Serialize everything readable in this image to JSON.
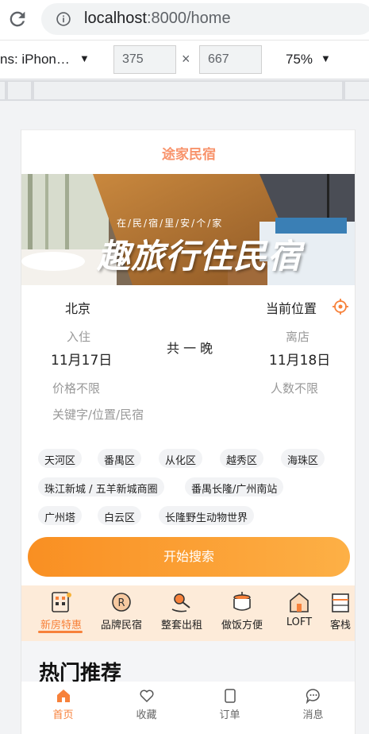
{
  "browser": {
    "url_host": "localhost",
    "url_path": ":8000/home",
    "device": "ns: iPhon…",
    "width": "375",
    "height": "667",
    "size_separator": "×",
    "zoom": "75%",
    "caret": "▼"
  },
  "app": {
    "title": "途家民宿",
    "banner_sub": "在/民/宿/里/安/个/家",
    "banner_main": "趣旅行住民宿"
  },
  "search": {
    "city": "北京",
    "current_location": "当前位置",
    "checkin_label": "入住",
    "checkin_date": "11月17日",
    "nights": "共 一 晚",
    "checkout_label": "离店",
    "checkout_date": "11月18日",
    "price": "价格不限",
    "people": "人数不限",
    "keyword_placeholder": "关键字/位置/民宿",
    "tags": [
      "天河区",
      "番禺区",
      "从化区",
      "越秀区",
      "海珠区",
      "珠江新城 / 五羊新城商圈",
      "番禺长隆/广州南站",
      "广州塔",
      "白云区",
      "长隆野生动物世界"
    ],
    "button": "开始搜索"
  },
  "categories": [
    "新房特惠",
    "品牌民宿",
    "整套出租",
    "做饭方便",
    "LOFT",
    "客栈"
  ],
  "hot": {
    "title": "热门推荐"
  },
  "tabbar": [
    "首页",
    "收藏",
    "订单",
    "消息"
  ],
  "colors": {
    "accent": "#f7813a",
    "title": "#f8936b",
    "category_bg": "#fdebd9"
  }
}
